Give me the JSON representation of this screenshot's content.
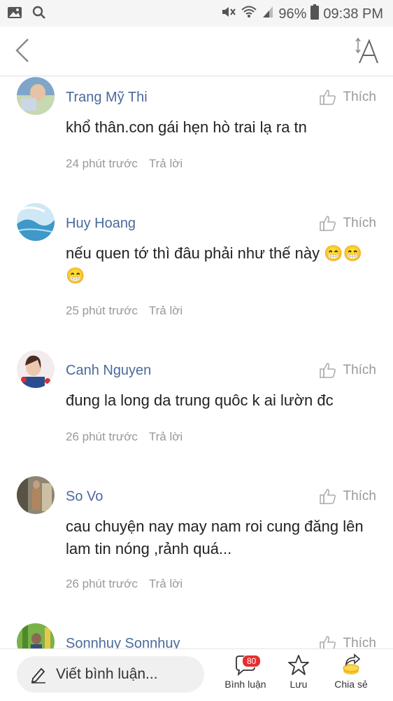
{
  "status_bar": {
    "battery": "96%",
    "time": "09:38 PM"
  },
  "comments": [
    {
      "name": "Trang Mỹ Thi",
      "like_label": "Thích",
      "text": "khổ thân.con gái hẹn hò trai lạ ra tn",
      "time": "24 phút trước",
      "reply_label": "Trả lời"
    },
    {
      "name": "Huy Hoang",
      "like_label": "Thích",
      "text": "nếu quen tớ thì đâu phải như thế này 😁😁 😁",
      "time": "25 phút trước",
      "reply_label": "Trả lời"
    },
    {
      "name": "Canh Nguyen",
      "like_label": "Thích",
      "text": "đung la long da trung quôc k ai lườn đc",
      "time": "26 phút trước",
      "reply_label": "Trả lời"
    },
    {
      "name": "So Vo",
      "like_label": "Thích",
      "text": "cau chuyện nay may nam roi cung đăng lên lam tin nóng ,rảnh quá...",
      "time": "26 phút trước",
      "reply_label": "Trả lời"
    },
    {
      "name": "Sonnhuy Sonnhuy",
      "like_label": "Thích"
    }
  ],
  "bottom_bar": {
    "input_placeholder": "Viết bình luận...",
    "comments_label": "Bình luận",
    "comments_count": "80",
    "save_label": "Lưu",
    "share_label": "Chia sẻ"
  },
  "colors": {
    "name_link": "#4a6a9b",
    "badge": "#e62e2e",
    "muted": "#999999"
  }
}
